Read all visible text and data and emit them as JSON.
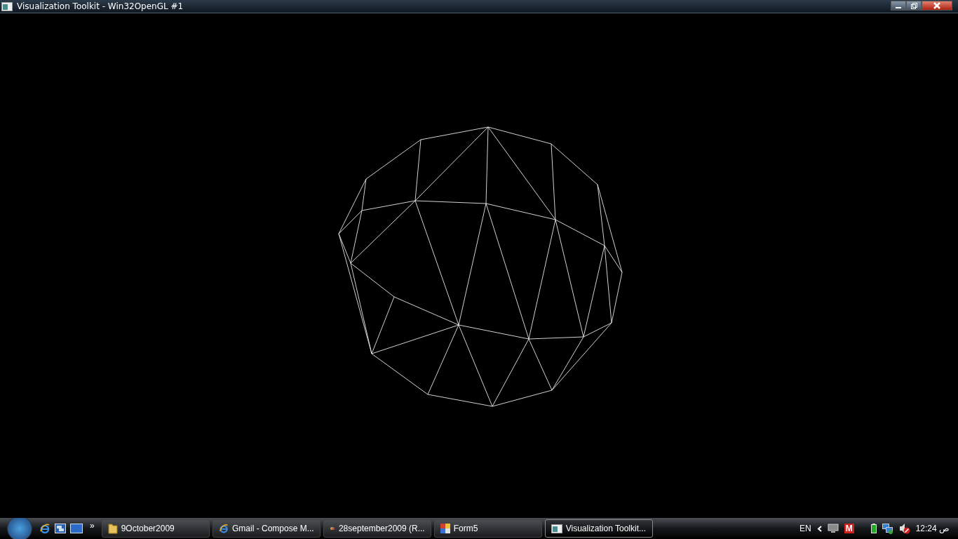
{
  "window": {
    "title": "Visualization Toolkit - Win32OpenGL #1"
  },
  "taskbar": {
    "quick_launch": [
      {
        "kind": "ie"
      },
      {
        "kind": "windows"
      },
      {
        "kind": "desktop"
      }
    ],
    "more": "»",
    "tasks": [
      {
        "label": "9October2009",
        "kind": "folder",
        "selected": false
      },
      {
        "label": "Gmail - Compose M...",
        "kind": "ie",
        "selected": false
      },
      {
        "label": "28september2009 (R...",
        "kind": "paint",
        "selected": false
      },
      {
        "label": "Form5",
        "kind": "form",
        "selected": false
      },
      {
        "label": "Visualization Toolkit...",
        "kind": "window",
        "selected": true
      }
    ],
    "language": "EN",
    "tray_badge": "M",
    "clock": "12:24 ص"
  }
}
